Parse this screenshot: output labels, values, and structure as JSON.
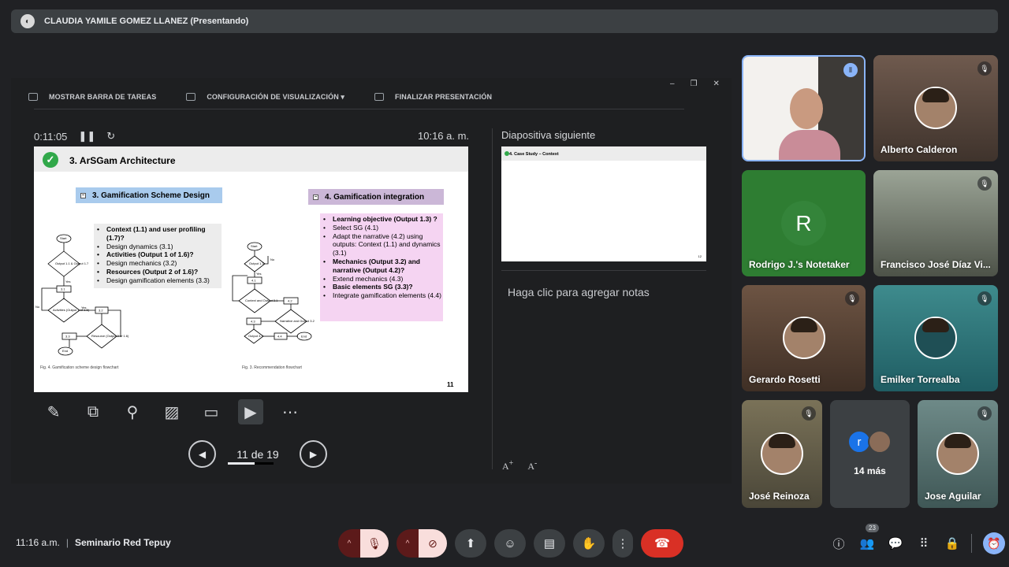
{
  "presenter_bar": {
    "title": "CLAUDIA YAMILE GOMEZ LLANEZ (Presentando)"
  },
  "presenter_view": {
    "menu": [
      "MOSTRAR BARRA DE TAREAS",
      "CONFIGURACIÓN DE VISUALIZACIÓN ▾",
      "FINALIZAR PRESENTACIÓN"
    ],
    "timer": "0:11:05",
    "clock": "10:16 a. m.",
    "next_label": "Diapositiva siguiente",
    "notes_placeholder": "Haga clic para agregar notas",
    "page_count": "11 de 19",
    "progress": 0.58,
    "font_increase": "A",
    "font_decrease": "A"
  },
  "slide": {
    "title": "3. ArSGam Architecture",
    "section1": "3. Gamification Scheme Design",
    "section2": "4. Gamification integration",
    "bullets1": [
      {
        "text": "Context (1.1) and user profiling (1.7)?",
        "bold": true
      },
      {
        "text": "Design dynamics (3.1)",
        "bold": false
      },
      {
        "text": "Activities (Output 1 of 1.6)?",
        "bold": true
      },
      {
        "text": "Design mechanics (3.2)",
        "bold": false
      },
      {
        "text": "Resources (Output 2 of 1.6)?",
        "bold": true
      },
      {
        "text": "Design gamification elements (3.3)",
        "bold": false
      }
    ],
    "bullets2": [
      {
        "text": "Learning objective (Output 1.3) ?",
        "bold": true
      },
      {
        "text": "Select SG (4.1)",
        "bold": false
      },
      {
        "text": "Adapt the narrative (4.2) using outputs: Context (1.1) and dynamics (3.1)",
        "bold": false
      },
      {
        "text": "Mechanics (Output 3.2) and narrative (Output 4.2)?",
        "bold": true
      },
      {
        "text": "Extend mechanics (4.3)",
        "bold": false
      },
      {
        "text": "Basic elements SG (3.3)?",
        "bold": true
      },
      {
        "text": "Integrate gamification elements (4.4)",
        "bold": false
      }
    ],
    "caption1": "Fig. 4. Gamification scheme design flowchart",
    "caption2": "Fig. 3. Recommendation flowchart",
    "page_number": "11",
    "flow": {
      "start": "Start",
      "end": "End",
      "yes": "Yes",
      "no": "No",
      "d1": "Output 1.1 & Output 1.7",
      "d2": "Activities (Output 1 of 1.6)",
      "d3": "Resource (Output 2 of 1.6)",
      "b31": "3.1",
      "b32": "3.2",
      "b33": "3.3",
      "f_d1": "Output 1.3",
      "f_41": "4.1",
      "f_d2": "Context and Output 3.1",
      "f_42": "4.2",
      "f_43": "4.3",
      "f_d3": "Narrative and Output 3.2",
      "f_d4": "Output 3.3",
      "f_44": "4.4"
    }
  },
  "next_slide": {
    "title": "4. Case Study – Context",
    "page_number": "12"
  },
  "participants": [
    {
      "name": "",
      "speaking": true
    },
    {
      "name": "Alberto Calderon",
      "muted": true
    },
    {
      "name": "Rodrigo J.'s Notetaker",
      "initial": "R"
    },
    {
      "name": "Francisco José Díaz Vi...",
      "muted": true
    },
    {
      "name": "Gerardo Rosetti",
      "muted": true
    },
    {
      "name": "Emilker Torrealba",
      "muted": true
    },
    {
      "name": "José Reinoza",
      "muted": true
    },
    {
      "name": "",
      "initial": "r",
      "more": "14 más"
    },
    {
      "name": "Jose Aguilar",
      "muted": true
    }
  ],
  "bottom": {
    "time": "11:16 a.m.",
    "meeting": "Seminario Red Tepuy",
    "people_count": "23"
  },
  "colors": {
    "background": "#202124",
    "end_call": "#d93025",
    "accent": "#8ab4f8",
    "slide_check": "#31a84a"
  }
}
